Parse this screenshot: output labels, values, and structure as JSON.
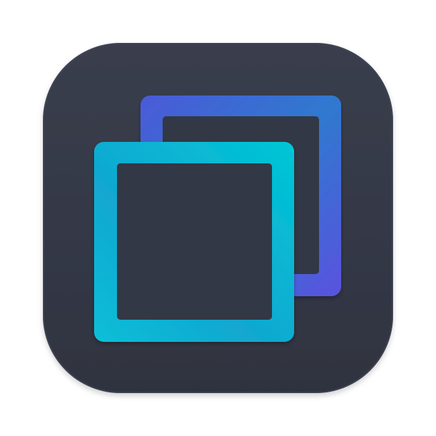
{
  "icon": {
    "semantic": "overlapping-squares-icon",
    "colors": {
      "tile_background": "#343846",
      "tile_edge_highlight": "#454a5a",
      "inner_fill": "#333744",
      "back_frame_gradient_start": "#4a5ad8",
      "back_frame_gradient_mid": "#2f79cf",
      "back_frame_gradient_end": "#5a52de",
      "front_frame_gradient_start": "#00c6d6",
      "front_frame_gradient_mid": "#12a7d0",
      "front_frame_gradient_end": "#0ebfd8"
    }
  }
}
